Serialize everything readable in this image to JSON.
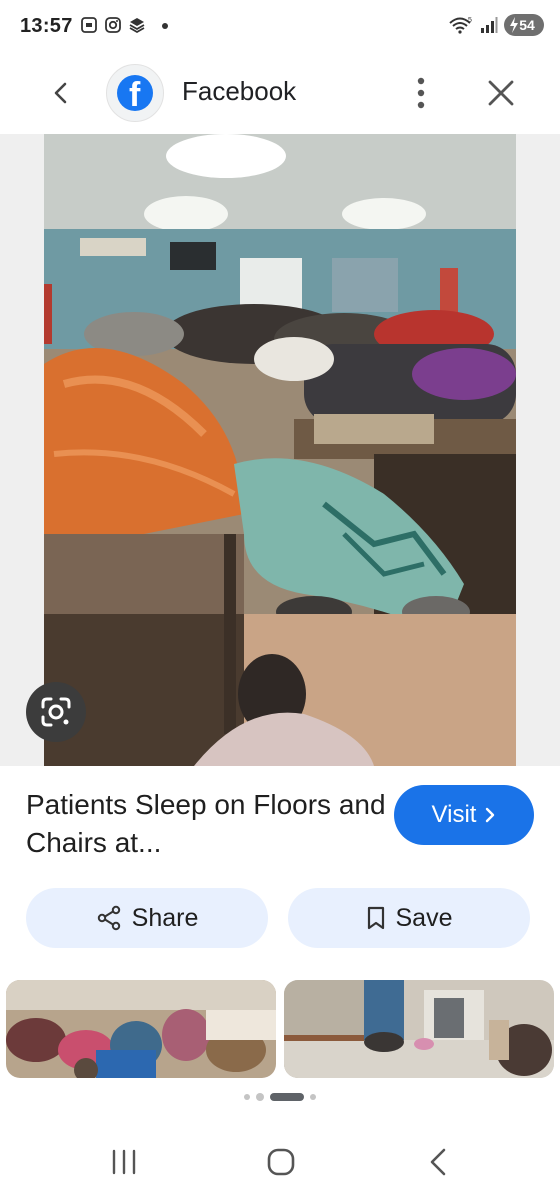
{
  "status": {
    "time": "13:57",
    "battery": "54",
    "icons": [
      "screenshot-icon",
      "instagram-icon",
      "stack-icon",
      "wifi-icon",
      "signal-icon",
      "battery-icon"
    ]
  },
  "header": {
    "source_name": "Facebook",
    "icons": [
      "back-arrow-icon",
      "facebook-logo",
      "more-vert-icon",
      "close-icon"
    ]
  },
  "image": {
    "lens_icon": "google-lens-icon"
  },
  "result": {
    "title": "Patients Sleep on Floors and Chairs at...",
    "visit_label": "Visit",
    "share_label": "Share",
    "save_label": "Save"
  },
  "pager": {
    "count": 4,
    "active": 2
  },
  "nav": {
    "icons": [
      "recents-icon",
      "home-icon",
      "back-icon"
    ]
  },
  "colors": {
    "accent": "#1a73e8",
    "chip_bg": "#e8f0fe",
    "facebook_blue": "#1877f2"
  }
}
